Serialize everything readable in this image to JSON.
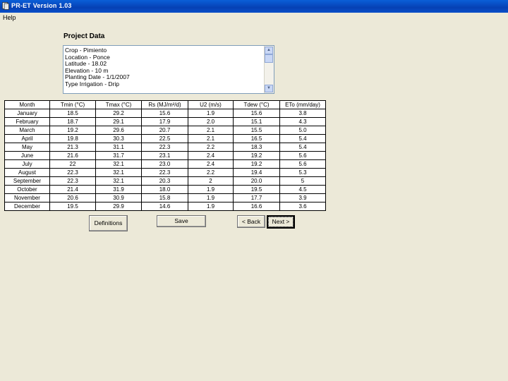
{
  "window": {
    "title": "PR-ET Version 1.03"
  },
  "menu": {
    "help": "Help"
  },
  "project": {
    "heading": "Project Data",
    "lines": [
      "Crop - Pimiento",
      "Location - Ponce",
      "Latitude - 18.02",
      "Elevation - 10 m",
      "Planting Date - 1/1/2007",
      "Type Irrigation - Drip"
    ]
  },
  "table": {
    "headers": [
      "Month",
      "Tmin (°C)",
      "Tmax (°C)",
      "Rs (MJ/m²/d)",
      "U2 (m/s)",
      "Tdew (°C)",
      "ETo (mm/day)"
    ],
    "rows": [
      [
        "January",
        "18.5",
        "29.2",
        "15.6",
        "1.9",
        "15.6",
        "3.8"
      ],
      [
        "February",
        "18.7",
        "29.1",
        "17.9",
        "2.0",
        "15.1",
        "4.3"
      ],
      [
        "March",
        "19.2",
        "29.6",
        "20.7",
        "2.1",
        "15.5",
        "5.0"
      ],
      [
        "April",
        "19.8",
        "30.3",
        "22.5",
        "2.1",
        "16.5",
        "5.4"
      ],
      [
        "May",
        "21.3",
        "31.1",
        "22.3",
        "2.2",
        "18.3",
        "5.4"
      ],
      [
        "June",
        "21.6",
        "31.7",
        "23.1",
        "2.4",
        "19.2",
        "5.6"
      ],
      [
        "July",
        "22",
        "32.1",
        "23.0",
        "2.4",
        "19.2",
        "5.6"
      ],
      [
        "August",
        "22.3",
        "32.1",
        "22.3",
        "2.2",
        "19.4",
        "5.3"
      ],
      [
        "September",
        "22.3",
        "32.1",
        "20.3",
        "2",
        "20.0",
        "5"
      ],
      [
        "October",
        "21.4",
        "31.9",
        "18.0",
        "1.9",
        "19.5",
        "4.5"
      ],
      [
        "November",
        "20.6",
        "30.9",
        "15.8",
        "1.9",
        "17.7",
        "3.9"
      ],
      [
        "December",
        "19.5",
        "29.9",
        "14.6",
        "1.9",
        "16.6",
        "3.6"
      ]
    ]
  },
  "buttons": {
    "definitions": "Definitions",
    "save": "Save",
    "back": "< Back",
    "next": "Next >"
  }
}
